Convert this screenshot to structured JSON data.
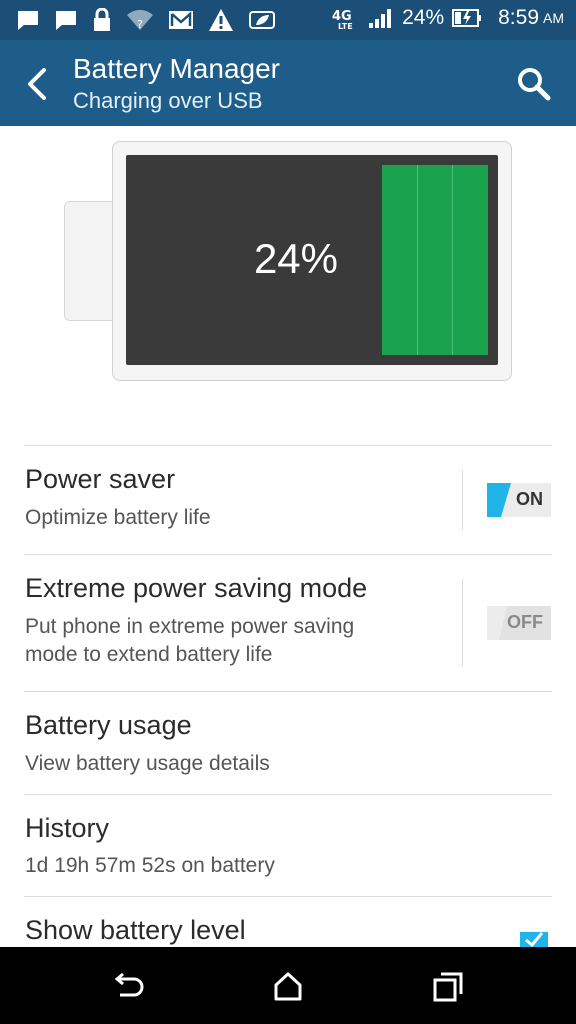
{
  "status_bar": {
    "battery_percent": "24%",
    "time": "8:59",
    "ampm": "AM",
    "network": "4G LTE",
    "icons": [
      "message-icon",
      "message-icon",
      "lock-icon",
      "wifi-question-icon",
      "gmail-icon",
      "warning-icon",
      "leaf-icon"
    ]
  },
  "appbar": {
    "title": "Battery Manager",
    "subtitle": "Charging over USB"
  },
  "battery": {
    "level_label": "24%",
    "level_fraction": 0.24,
    "fill_color": "#1aa24f"
  },
  "items": {
    "power_saver": {
      "title": "Power saver",
      "subtitle": "Optimize battery life",
      "toggle": "ON"
    },
    "extreme": {
      "title": "Extreme power saving mode",
      "subtitle_line1": "Put phone in extreme power saving",
      "subtitle_line2": "mode to extend battery life",
      "toggle": "OFF"
    },
    "usage": {
      "title": "Battery usage",
      "subtitle": "View battery usage details"
    },
    "history": {
      "title": "History",
      "subtitle": "1d 19h 57m 52s on battery"
    },
    "show_level": {
      "title": "Show battery level",
      "checked": true
    }
  },
  "colors": {
    "statusbar": "#1b4f77",
    "appbar": "#1e5d8a",
    "accent": "#1fb5e8"
  }
}
